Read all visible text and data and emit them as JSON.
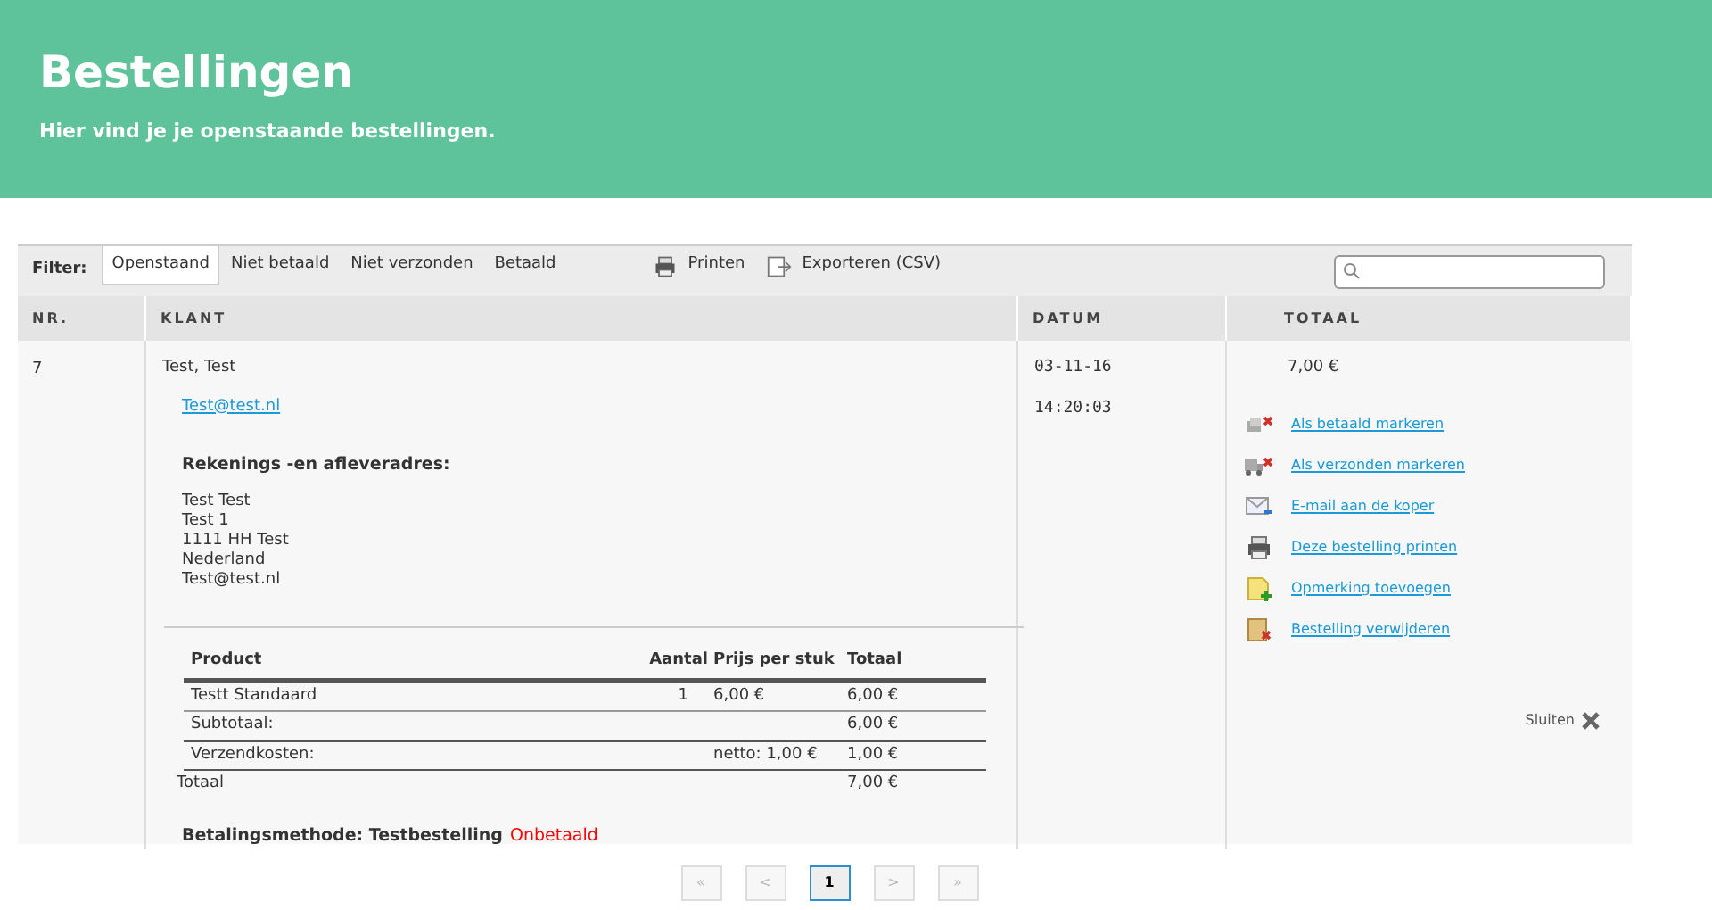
{
  "header": {
    "title": "Bestellingen",
    "subtitle": "Hier vind je je openstaande bestellingen."
  },
  "filter": {
    "label": "Filter:",
    "tabs": [
      {
        "label": "Openstaand",
        "selected": true
      },
      {
        "label": "Niet betaald",
        "selected": false
      },
      {
        "label": "Niet verzonden",
        "selected": false
      },
      {
        "label": "Betaald",
        "selected": false
      }
    ],
    "tools": [
      {
        "kind": "print",
        "label": "Printen"
      },
      {
        "kind": "export",
        "label": "Exporteren (CSV)"
      }
    ]
  },
  "table": {
    "columns": [
      "NR.",
      "KLANT",
      "DATUM",
      "TOTAAL"
    ],
    "order": {
      "nr": "7",
      "customer": "Test, Test",
      "email": "Test@test.nl",
      "address_heading": "Rekenings -en afleveradres:",
      "address": [
        "Test Test",
        "Test 1",
        "1111 HH Test",
        "Nederland",
        "Test@test.nl"
      ],
      "products": {
        "columns": [
          "Product",
          "Aantal",
          "Prijs per stuk",
          "Totaal"
        ],
        "rows": [
          {
            "kind": "item",
            "cells": [
              "Testt Standaard",
              "1",
              "6,00 €",
              "6,00 €"
            ]
          },
          {
            "kind": "sub",
            "cells": [
              "Subtotaal:",
              "",
              "",
              "6,00 €"
            ]
          },
          {
            "kind": "sub",
            "cells": [
              "Verzendkosten:",
              "",
              "netto: 1,00 €",
              "1,00 €"
            ]
          },
          {
            "kind": "total",
            "cells": [
              "Totaal",
              "",
              "",
              "7,00 €"
            ]
          }
        ]
      },
      "payment_label": "Betalingsmethode: Testbestelling",
      "payment_status": "Onbetaald",
      "date": "03-11-16",
      "time": "14:20:03",
      "total": "7,00 €",
      "actions": [
        {
          "kind": "paid",
          "label": "Als betaald markeren"
        },
        {
          "kind": "shipped",
          "label": "Als verzonden markeren"
        },
        {
          "kind": "email",
          "label": "E-mail aan de koper"
        },
        {
          "kind": "print",
          "label": "Deze bestelling printen"
        },
        {
          "kind": "note",
          "label": "Opmerking toevoegen"
        },
        {
          "kind": "delete",
          "label": "Bestelling verwijderen"
        }
      ],
      "close": "Sluiten"
    }
  },
  "pagination": [
    {
      "label": "«",
      "selected": false
    },
    {
      "label": "<",
      "selected": false
    },
    {
      "label": "1",
      "selected": true
    },
    {
      "label": ">",
      "selected": false
    },
    {
      "label": "»",
      "selected": false
    }
  ]
}
